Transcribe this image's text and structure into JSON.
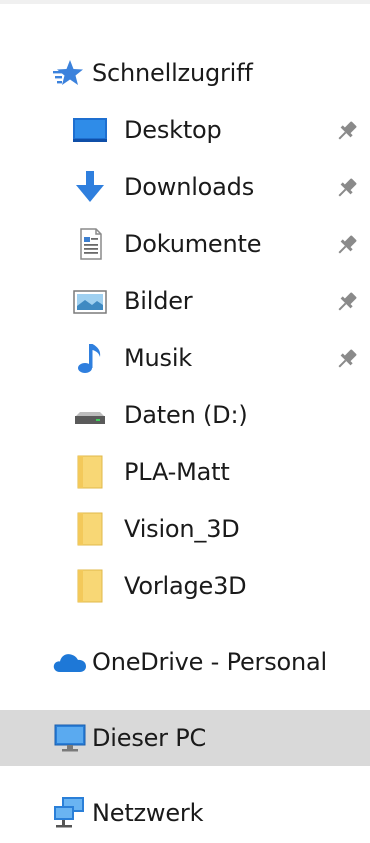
{
  "nav": {
    "quick_access": {
      "label": "Schnellzugriff",
      "icon": "star-icon",
      "items": [
        {
          "label": "Desktop",
          "icon": "desktop-icon",
          "pinned": true
        },
        {
          "label": "Downloads",
          "icon": "download-arrow-icon",
          "pinned": true
        },
        {
          "label": "Dokumente",
          "icon": "document-icon",
          "pinned": true
        },
        {
          "label": "Bilder",
          "icon": "pictures-icon",
          "pinned": true
        },
        {
          "label": "Musik",
          "icon": "music-note-icon",
          "pinned": true
        },
        {
          "label": "Daten (D:)",
          "icon": "drive-icon",
          "pinned": false
        },
        {
          "label": "PLA-Matt",
          "icon": "folder-icon",
          "pinned": false
        },
        {
          "label": "Vision_3D",
          "icon": "folder-icon",
          "pinned": false
        },
        {
          "label": "Vorlage3D",
          "icon": "folder-icon",
          "pinned": false
        }
      ]
    },
    "onedrive": {
      "label": "OneDrive - Personal",
      "icon": "cloud-icon"
    },
    "this_pc": {
      "label": "Dieser PC",
      "icon": "computer-icon",
      "selected": true
    },
    "network": {
      "label": "Netzwerk",
      "icon": "network-icon"
    }
  },
  "colors": {
    "selected_bg": "#d9d9d9",
    "accent_blue": "#1e78d7",
    "folder_yellow": "#f8d775"
  }
}
